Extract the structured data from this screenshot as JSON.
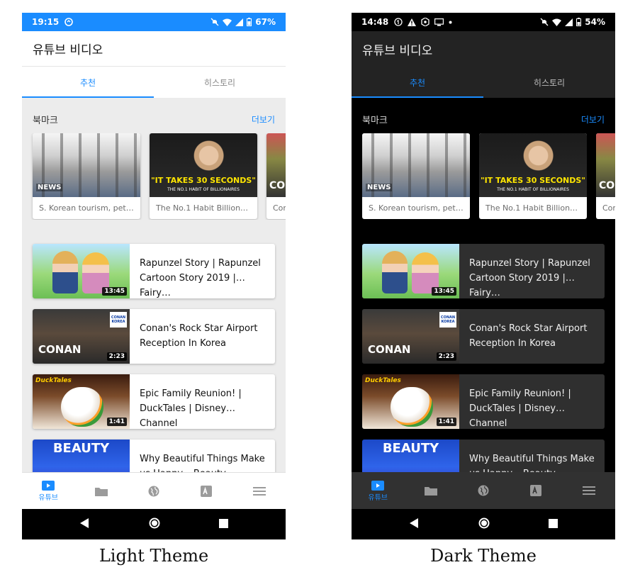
{
  "panels": {
    "light": {
      "status": {
        "time": "19:15",
        "battery": "67%"
      },
      "caption": "Light Theme"
    },
    "dark": {
      "status": {
        "time": "14:48",
        "battery": "54%"
      },
      "caption": "Dark Theme"
    }
  },
  "app": {
    "title": "유튜브 비디오",
    "tabs": [
      "추천",
      "히스토리"
    ],
    "bookmarks_title": "북마크",
    "more_label": "더보기",
    "bookmarks": [
      {
        "title": "S. Korean tourism, pet…",
        "thumb_text": "NEWS"
      },
      {
        "title": "The No.1 Habit Billion…",
        "thumb_text": "\"IT TAKES 30 SECONDS\"",
        "thumb_subtext": "THE NO.1 HABIT OF BILLIONAIRES"
      },
      {
        "title": "Cor",
        "thumb_text": "CO"
      }
    ],
    "videos": [
      {
        "title": "Rapunzel Story | Rapunzel Cartoon Story 2019 | Fairy…",
        "duration": "13:45"
      },
      {
        "title": "Conan's Rock Star Airport Reception In Korea",
        "duration": "2:23",
        "thumb_text": "CONAN",
        "badge_text": "CONAN KOREA"
      },
      {
        "title": "Epic Family Reunion! | DuckTales | Disney Channel",
        "duration": "1:41",
        "thumb_text": "DuckTales"
      },
      {
        "title": "Why Beautiful Things Make us Happy – Beauty",
        "thumb_text": "BEAUTY"
      }
    ],
    "nav": [
      {
        "label": "유튜브",
        "icon": "play-icon"
      },
      {
        "label": "",
        "icon": "folder-icon"
      },
      {
        "label": "",
        "icon": "globe-icon"
      },
      {
        "label": "",
        "icon": "translate-icon"
      },
      {
        "label": "",
        "icon": "menu-icon"
      }
    ]
  },
  "colors": {
    "accent": "#1a8cff",
    "light_status_bar": "#1a8cff",
    "dark_app_bar": "#232323",
    "dark_card": "#2f2f2f"
  }
}
